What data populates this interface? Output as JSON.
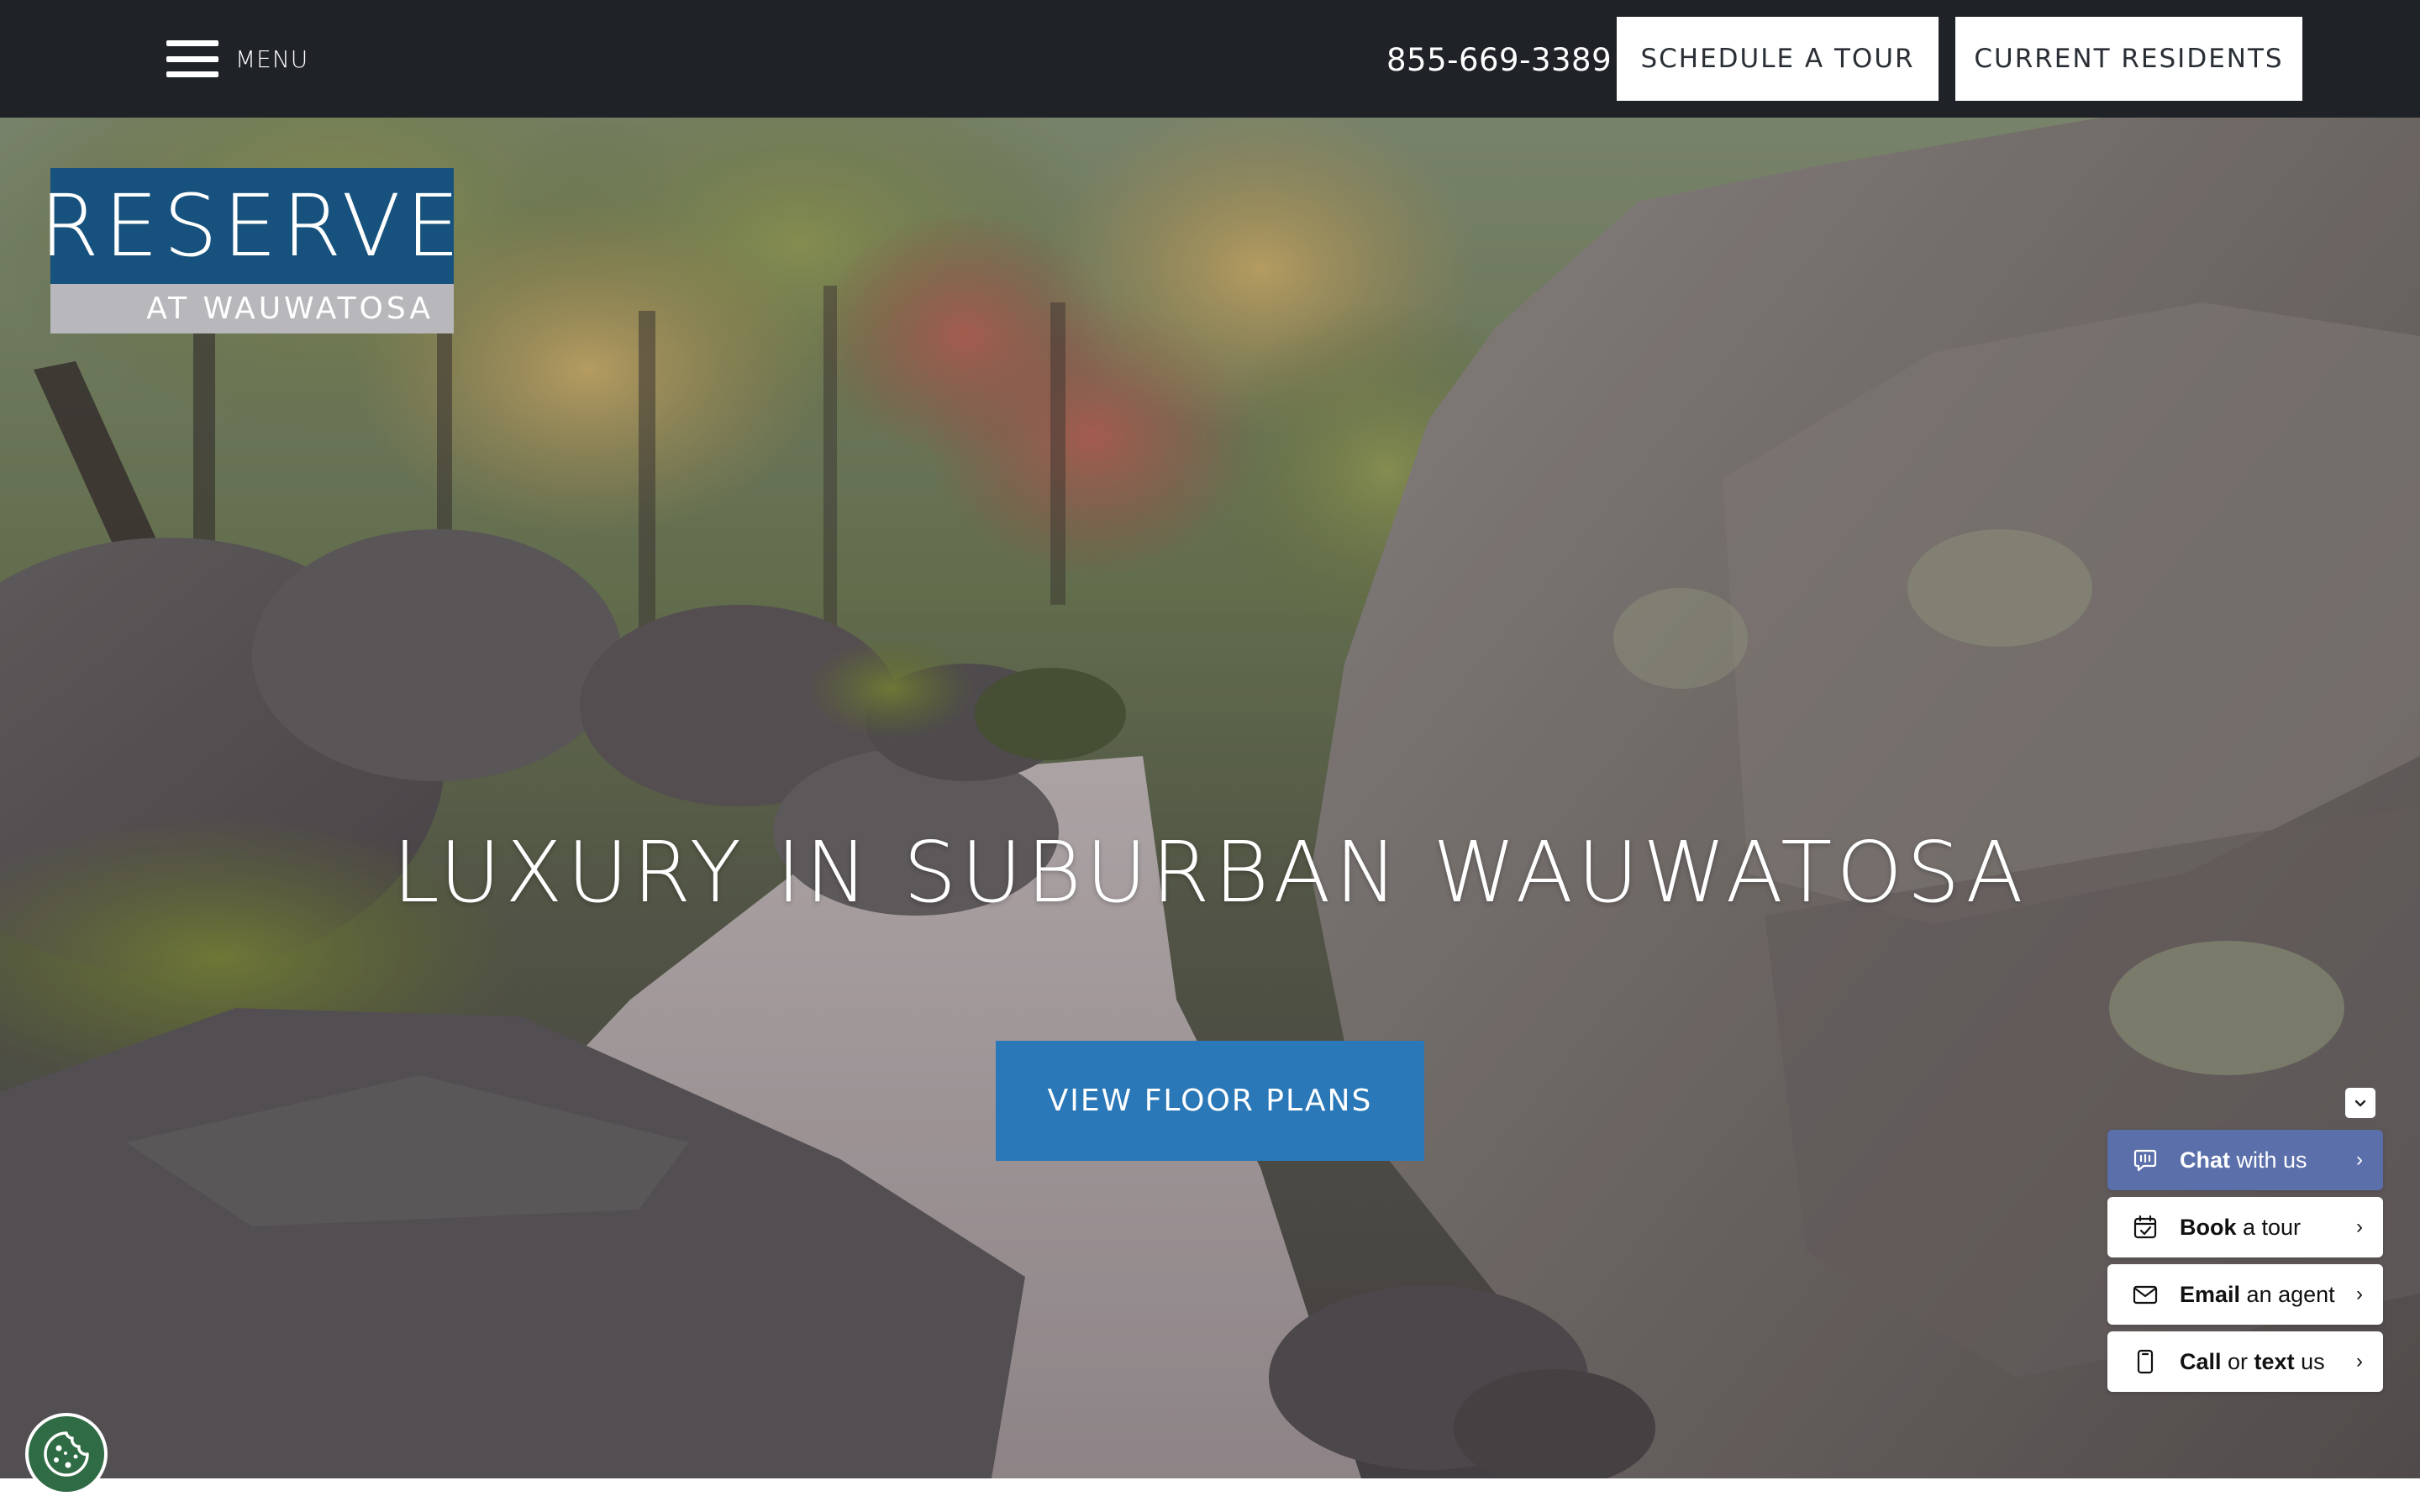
{
  "header": {
    "menu_label": "MENU",
    "phone": "855-669-3389",
    "schedule_tour": "SCHEDULE A TOUR",
    "current_residents": "CURRENT RESIDENTS"
  },
  "logo": {
    "name": "RESERVE",
    "subtitle": "AT WAUWATOSA",
    "primary_color": "#16527d",
    "secondary_color": "#b8b8bc"
  },
  "hero": {
    "title": "LUXURY IN SUBURBAN WAUWATOSA",
    "cta_label": "VIEW FLOOR PLANS",
    "cta_color": "#2a78b8"
  },
  "contact_widget": {
    "items": [
      {
        "icon": "chat-icon",
        "bold": "Chat",
        "rest": " with us"
      },
      {
        "icon": "calendar-icon",
        "bold": "Book",
        "rest": " a tour"
      },
      {
        "icon": "envelope-icon",
        "bold": "Email",
        "rest": " an agent"
      },
      {
        "icon": "phone-icon",
        "bold": "Call",
        "mid": " or ",
        "bold2": "text",
        "rest": " us"
      }
    ],
    "chat_color": "#5b6fab"
  },
  "cookie_button": {
    "icon": "cookie-icon",
    "color": "#2f6b44"
  },
  "colors": {
    "topbar": "#1f2328"
  }
}
